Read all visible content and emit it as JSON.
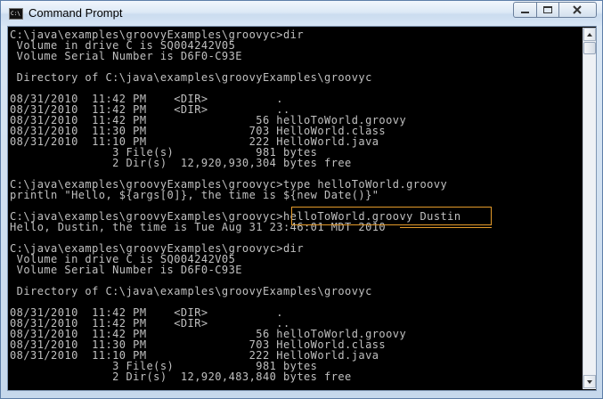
{
  "window": {
    "title": "Command Prompt",
    "icon_text": "C:\\"
  },
  "controls": {
    "minimize": "minimize-icon",
    "maximize": "maximize-icon",
    "close": "close-icon"
  },
  "console": {
    "lines": [
      "C:\\java\\examples\\groovyExamples\\groovyc>dir",
      " Volume in drive C is SQ004242V05",
      " Volume Serial Number is D6F0-C93E",
      "",
      " Directory of C:\\java\\examples\\groovyExamples\\groovyc",
      "",
      "08/31/2010  11:42 PM    <DIR>          .",
      "08/31/2010  11:42 PM    <DIR>          ..",
      "08/31/2010  11:42 PM                56 helloToWorld.groovy",
      "08/31/2010  11:30 PM               703 HelloWorld.class",
      "08/31/2010  11:10 PM               222 HelloWorld.java",
      "               3 File(s)            981 bytes",
      "               2 Dir(s)  12,920,930,304 bytes free",
      "",
      "C:\\java\\examples\\groovyExamples\\groovyc>type helloToWorld.groovy",
      "println \"Hello, ${args[0]}, the time is ${new Date()}\"",
      "",
      "C:\\java\\examples\\groovyExamples\\groovyc>helloToWorld.groovy Dustin",
      "Hello, Dustin, the time is Tue Aug 31 23:46:01 MDT 2010",
      "",
      "C:\\java\\examples\\groovyExamples\\groovyc>dir",
      " Volume in drive C is SQ004242V05",
      " Volume Serial Number is D6F0-C93E",
      "",
      " Directory of C:\\java\\examples\\groovyExamples\\groovyc",
      "",
      "08/31/2010  11:42 PM    <DIR>          .",
      "08/31/2010  11:42 PM    <DIR>          ..",
      "08/31/2010  11:42 PM                56 helloToWorld.groovy",
      "08/31/2010  11:30 PM               703 HelloWorld.class",
      "08/31/2010  11:10 PM               222 HelloWorld.java",
      "               3 File(s)            981 bytes",
      "               2 Dir(s)  12,920,483,840 bytes free"
    ]
  },
  "colors": {
    "console_bg": "#000000",
    "console_text": "#c0c0c0",
    "annotation": "#e39a2a"
  }
}
